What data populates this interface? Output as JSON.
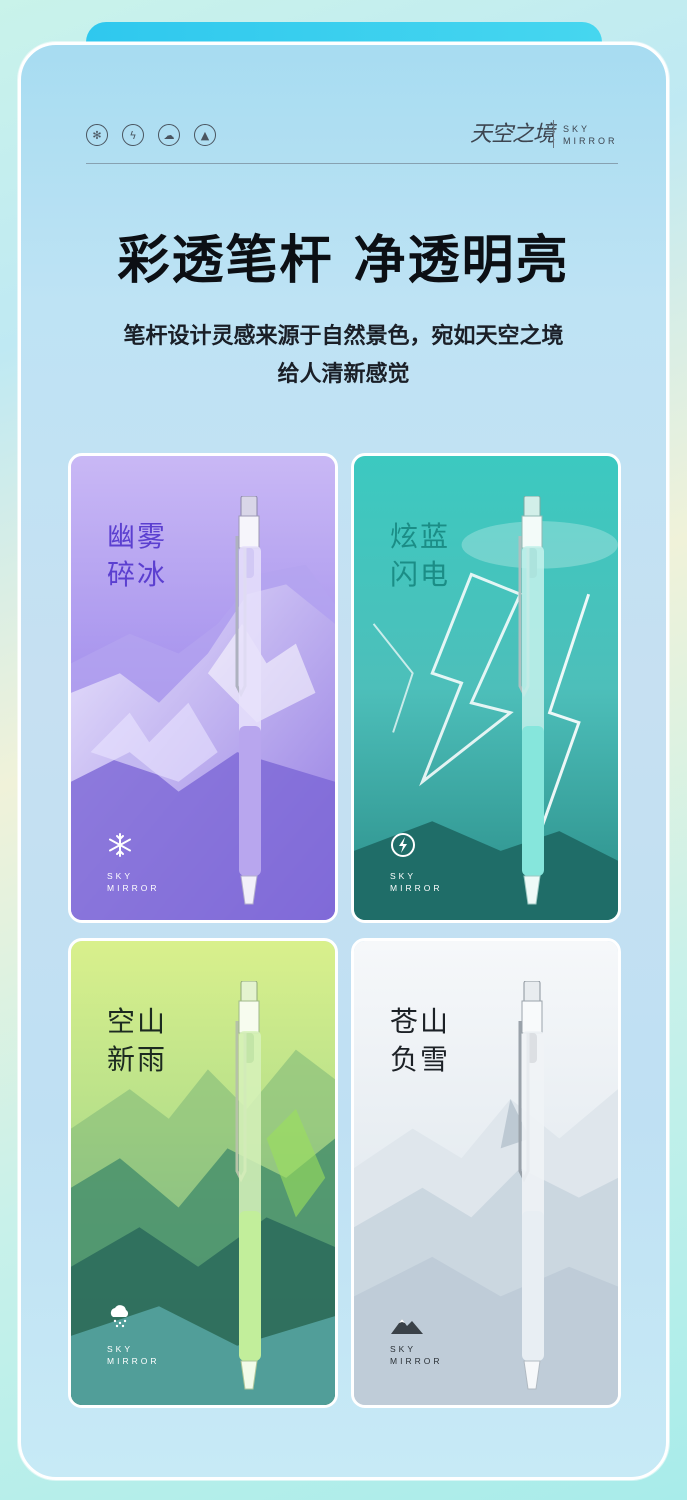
{
  "header": {
    "icons": [
      "snowflake-icon",
      "lightning-icon",
      "cloud-rain-icon",
      "mountain-icon"
    ],
    "logo_cn": "天空之境",
    "logo_en_line1": "SKY",
    "logo_en_line2": "MIRROR"
  },
  "headline": "彩透笔杆 净透明亮",
  "subtitle_line1": "笔杆设计灵感来源于自然景色，宛如天空之境",
  "subtitle_line2": "给人清新感觉",
  "cards": [
    {
      "title_line1": "幽雾",
      "title_line2": "碎冰",
      "brand_line1": "SKY",
      "brand_line2": "MIRROR",
      "icon": "snowflake-icon",
      "accent": "#5b3fd0",
      "pen_color": "#b8a6ee"
    },
    {
      "title_line1": "炫蓝",
      "title_line2": "闪电",
      "brand_line1": "SKY",
      "brand_line2": "MIRROR",
      "icon": "lightning-icon",
      "accent": "#1b8d86",
      "pen_color": "#86e6dc"
    },
    {
      "title_line1": "空山",
      "title_line2": "新雨",
      "brand_line1": "SKY",
      "brand_line2": "MIRROR",
      "icon": "cloud-rain-icon",
      "accent": "#1c2a20",
      "pen_color": "#c2ee9b"
    },
    {
      "title_line1": "苍山",
      "title_line2": "负雪",
      "brand_line1": "SKY",
      "brand_line2": "MIRROR",
      "icon": "mountain-icon",
      "accent": "#1c2126",
      "pen_color": "#e8eef3"
    }
  ]
}
